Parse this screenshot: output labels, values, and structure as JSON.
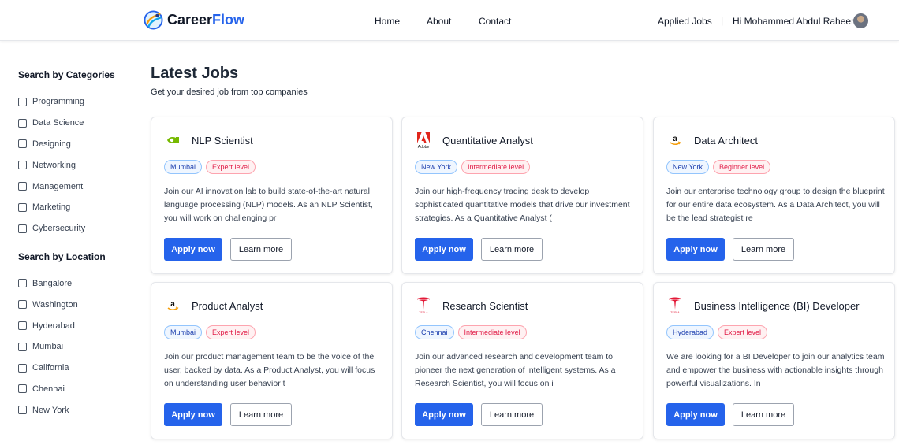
{
  "header": {
    "logo": {
      "career": "Career",
      "flow": "Flow"
    },
    "nav": {
      "home": "Home",
      "about": "About",
      "contact": "Contact"
    },
    "applied_jobs": "Applied Jobs",
    "separator": "|",
    "greeting": "Hi Mohammed Abdul Raheem"
  },
  "sidebar": {
    "categories_heading": "Search by Categories",
    "categories": [
      "Programming",
      "Data Science",
      "Designing",
      "Networking",
      "Management",
      "Marketing",
      "Cybersecurity"
    ],
    "location_heading": "Search by Location",
    "locations": [
      "Bangalore",
      "Washington",
      "Hyderabad",
      "Mumbai",
      "California",
      "Chennai",
      "New York"
    ]
  },
  "main": {
    "title": "Latest Jobs",
    "subtitle": "Get your desired job from top companies",
    "apply_label": "Apply now",
    "learn_label": "Learn more",
    "jobs": [
      {
        "company_icon": "nvidia-logo-icon",
        "title": "NLP Scientist",
        "location": "Mumbai",
        "level": "Expert level",
        "description": "Join our AI innovation lab to build state-of-the-art natural language processing (NLP) models. As an NLP Scientist, you will work on challenging pr"
      },
      {
        "company_icon": "adobe-logo-icon",
        "title": "Quantitative Analyst",
        "location": "New York",
        "level": "Intermediate level",
        "description": "Join our high-frequency trading desk to develop sophisticated quantitative models that drive our investment strategies. As a Quantitative Analyst ("
      },
      {
        "company_icon": "amazon-logo-icon",
        "title": "Data Architect",
        "location": "New York",
        "level": "Beginner level",
        "description": "Join our enterprise technology group to design the blueprint for our entire data ecosystem. As a Data Architect, you will be the lead strategist re"
      },
      {
        "company_icon": "amazon-logo-icon",
        "title": "Product Analyst",
        "location": "Mumbai",
        "level": "Expert level",
        "description": "Join our product management team to be the voice of the user, backed by data. As a Product Analyst, you will focus on understanding user behavior t"
      },
      {
        "company_icon": "tesla-logo-icon",
        "title": "Research Scientist",
        "location": "Chennai",
        "level": "Intermediate level",
        "description": "Join our advanced research and development team to pioneer the next generation of intelligent systems. As a Research Scientist, you will focus on i"
      },
      {
        "company_icon": "tesla-logo-icon",
        "title": "Business Intelligence (BI) Developer",
        "location": "Hyderabad",
        "level": "Expert level",
        "description": "We are looking for a BI Developer to join our analytics team and empower the business with actionable insights through powerful visualizations. In"
      }
    ]
  },
  "colors": {
    "primary": "#2563eb",
    "location_tag": "#1e40af",
    "level_tag": "#e11d48"
  }
}
